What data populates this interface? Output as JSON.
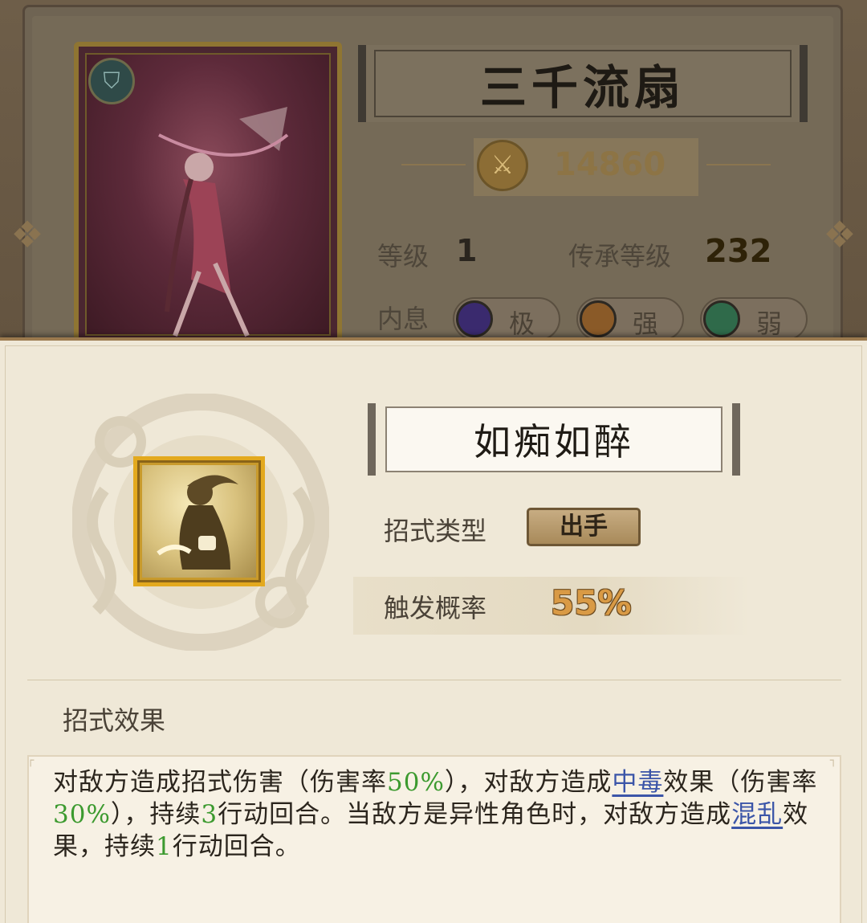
{
  "card": {
    "name": "三千流扇",
    "power": "14860",
    "level_label": "等级",
    "level_value": "1",
    "inherit_label": "传承等级",
    "inherit_value": "232",
    "energy_label": "内息",
    "energies": [
      {
        "grade": "极",
        "color": "#3a2a6e"
      },
      {
        "grade": "强",
        "color": "#8a5a28"
      },
      {
        "grade": "弱",
        "color": "#2f6a4a"
      }
    ]
  },
  "skill": {
    "name": "如痴如醉",
    "type_label": "招式类型",
    "type_value": "出手",
    "rate_label": "触发概率",
    "rate_value": "55%",
    "effect_heading": "招式效果",
    "effect": {
      "p1": "对敌方造成招式伤害（伤害率",
      "n1": "50%",
      "p2": "），对敌方造成",
      "l1": "中毒",
      "p3": "效果（伤害率",
      "n2": "30%",
      "p4": "），持续",
      "n3": "3",
      "p5": "行动回合。当敌方是异性角色时，对敌方造成",
      "l2": "混乱",
      "p6": "效果，持续",
      "n4": "1",
      "p7": "行动回合。"
    }
  },
  "colors": {
    "popup_bg": "#efe8d7",
    "highlight_number": "#3c9a2f",
    "highlight_link": "#3b55a8",
    "rate_value": "#d99a45"
  }
}
